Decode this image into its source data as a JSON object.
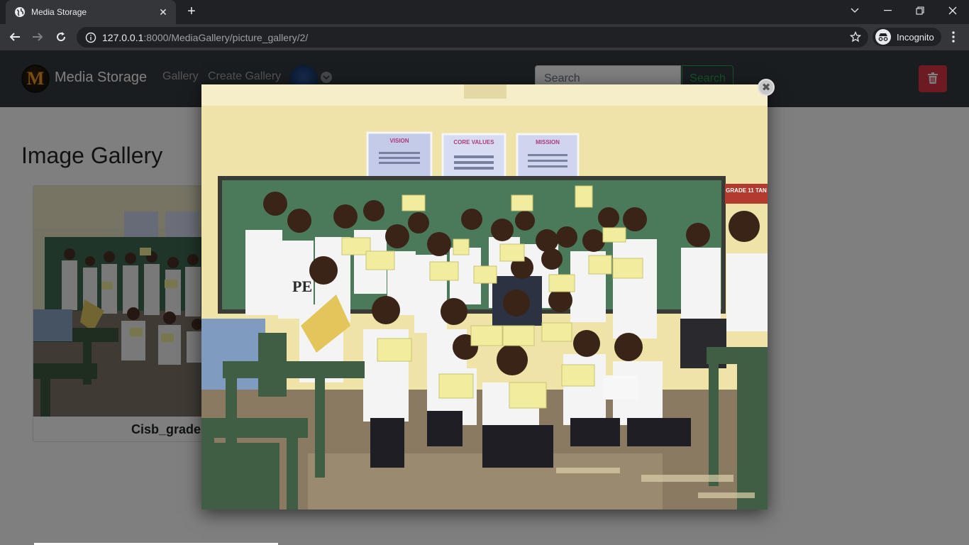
{
  "browser": {
    "tab_title": "Media Storage",
    "tab_close": "✕",
    "new_tab": "+",
    "url_host": "127.0.0.1",
    "url_rest": ":8000/MediaGallery/picture_gallery/2/",
    "incognito_label": "Incognito"
  },
  "navbar": {
    "brand_letter": "M",
    "brand_name": "Media Storage",
    "links": [
      "Gallery",
      "Create Gallery"
    ],
    "search_placeholder": "Search",
    "search_button": "Search"
  },
  "main": {
    "heading": "Image Gallery",
    "cards": [
      {
        "title": "Cisb_grade"
      }
    ]
  },
  "lightbox": {
    "close": "✖",
    "posters": [
      "VISION",
      "CORE VALUES",
      "MISSION"
    ],
    "classroom_sign": "GRADE 11 TAN",
    "shirt_print": "PE"
  },
  "colors": {
    "navbar_bg": "#343a40",
    "success": "#28a745",
    "danger": "#dc3545",
    "chrome_dark": "#202124",
    "chrome_mid": "#35363a"
  }
}
